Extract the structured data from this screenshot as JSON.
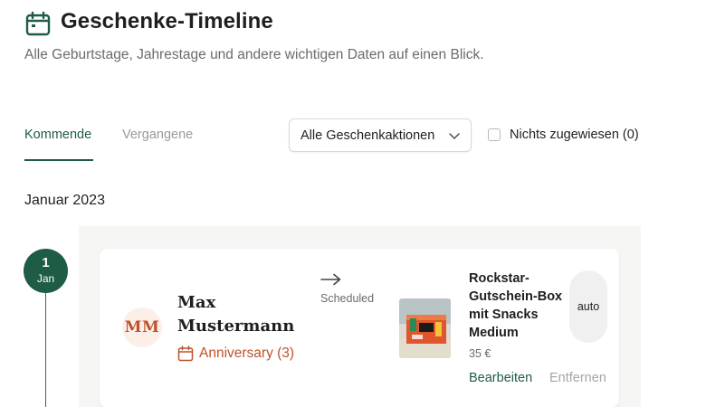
{
  "header": {
    "title": "Geschenke-Timeline",
    "subtitle": "Alle Geburtstage, Jahrestage und andere wichtigen Daten auf einen Blick.",
    "icon": "calendar-icon"
  },
  "tabs": [
    {
      "label": "Kommende",
      "active": true
    },
    {
      "label": "Vergangene",
      "active": false
    }
  ],
  "filter": {
    "selected": "Alle Geschenkaktionen",
    "unassigned_label": "Nichts zugewiesen (0)",
    "unassigned_checked": false
  },
  "month": "Januar 2023",
  "entry": {
    "date_day": "1",
    "date_month": "Jan",
    "initials": "MM",
    "name": "Max Mustermann",
    "occasion": "Anniversary (3)",
    "status": "Scheduled",
    "product_name": "Rockstar-Gutschein-Box mit Snacks Medium",
    "price": "35 €",
    "mode": "auto",
    "edit_label": "Bearbeiten",
    "remove_label": "Entfernen"
  },
  "colors": {
    "accent_green": "#1e5c45",
    "accent_orange": "#c0512a",
    "muted_text": "#6b6b6b",
    "panel_bg": "#f6f6f5"
  }
}
